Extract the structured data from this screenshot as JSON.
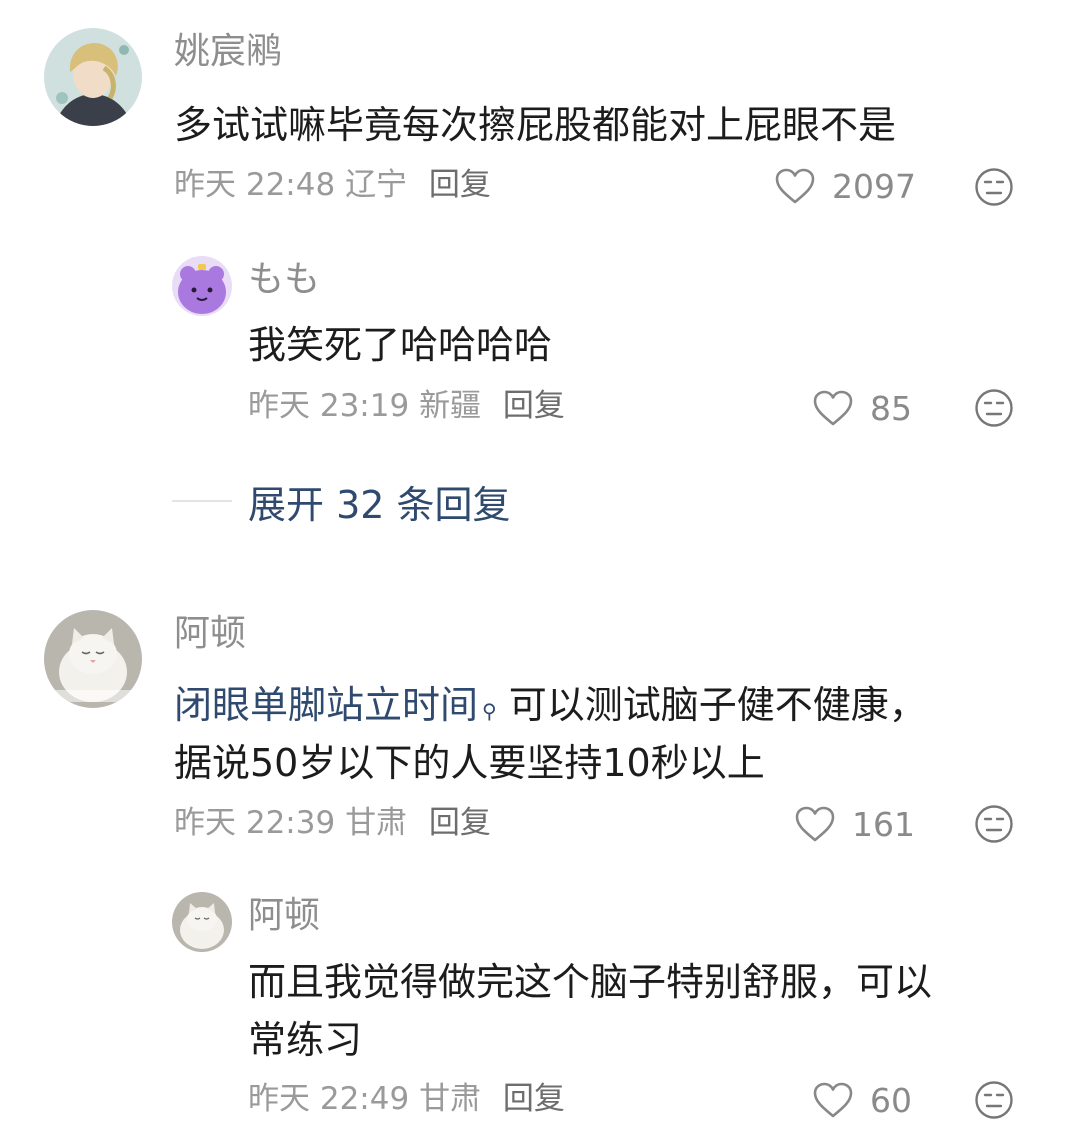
{
  "comments": [
    {
      "author": "姚宸鹇",
      "text_lines": [
        "多试试嘛毕竟每次擦屁股都能对上屁眼不是"
      ],
      "time": "昨天 22:48",
      "location": "辽宁",
      "reply_label": "回复",
      "likes": "2097",
      "reply": {
        "author": "もも",
        "text_lines": [
          "我笑死了哈哈哈哈"
        ],
        "time": "昨天 23:19",
        "location": "新疆",
        "reply_label": "回复",
        "likes": "85"
      },
      "expand_label": "展开 32 条回复"
    },
    {
      "author": "阿顿",
      "link_text": "闭眼单脚站立时间",
      "text_after_link": "可以测试脑子健不健康，",
      "text_line2": "据说50岁以下的人要坚持10秒以上",
      "time": "昨天 22:39",
      "location": "甘肃",
      "reply_label": "回复",
      "likes": "161",
      "reply": {
        "author": "阿顿",
        "text_lines": [
          "而且我觉得做完这个脑子特别舒服，可以",
          "常练习"
        ],
        "time": "昨天 22:49",
        "location": "甘肃",
        "reply_label": "回复",
        "likes": "60"
      }
    }
  ],
  "icons": {
    "like": "heart-outline-icon",
    "reaction": "neutral-face-icon",
    "link_search": "search-icon"
  },
  "colors": {
    "link": "#2f4a6e",
    "meta": "#9a9a9a",
    "name": "#8e8e8e"
  }
}
